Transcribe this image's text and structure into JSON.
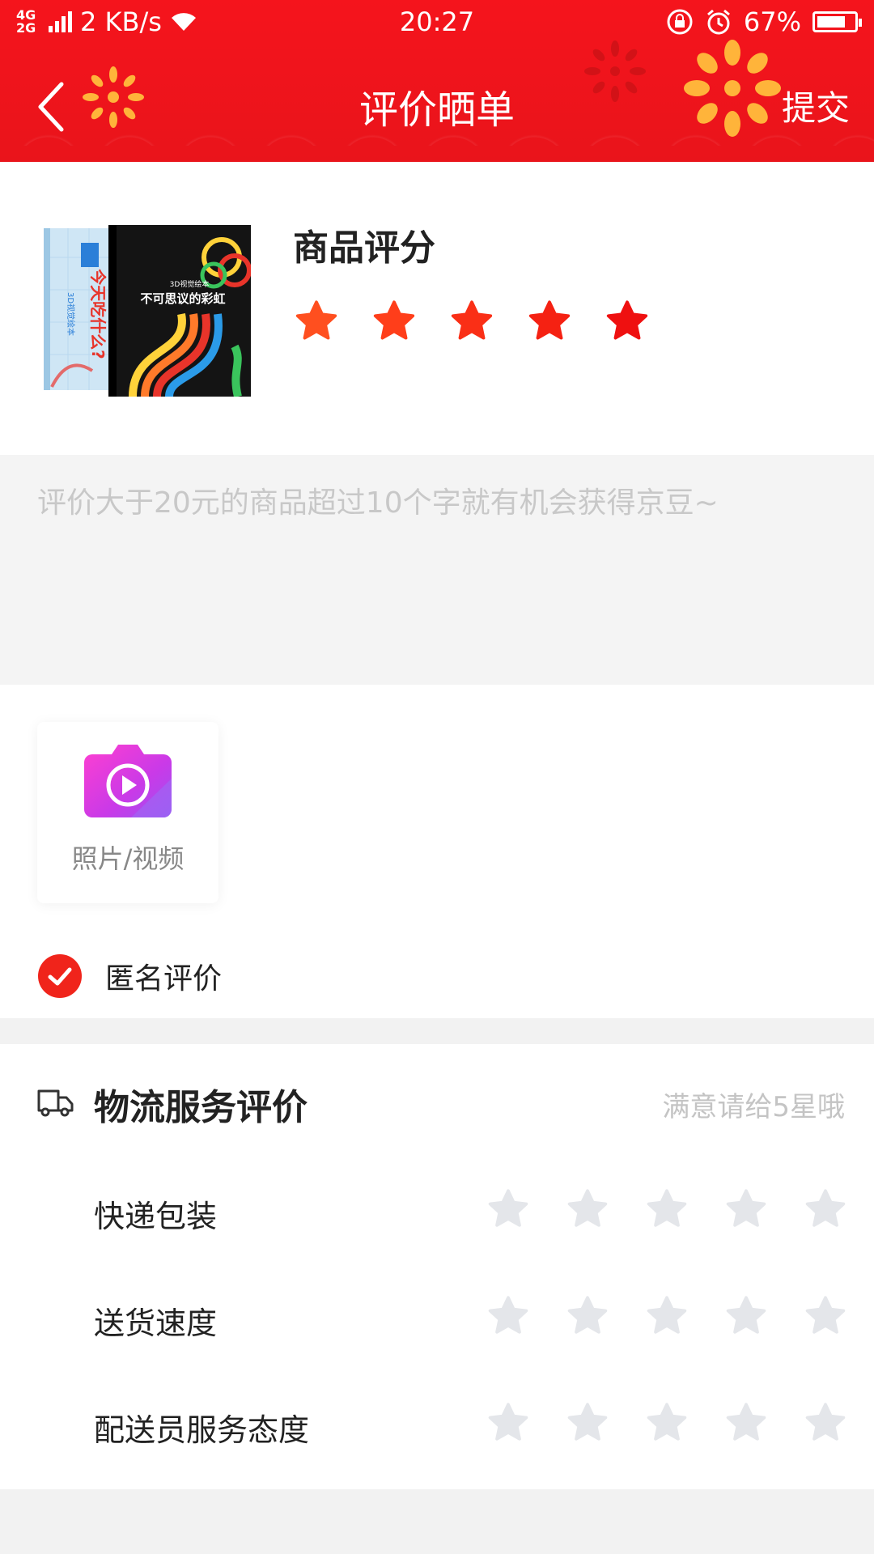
{
  "status_bar": {
    "network": "4G 2G",
    "speed": "2 KB/s",
    "time": "20:27",
    "battery_percent": "67%",
    "battery_level": 0.67
  },
  "nav": {
    "title": "评价晒单",
    "submit_label": "提交"
  },
  "product": {
    "rating_title": "商品评分",
    "rating": 5,
    "max_rating": 5,
    "star_colors": [
      "#ff4f1f",
      "#ff3e1a",
      "#fa2f16",
      "#f52112",
      "#ef1010"
    ],
    "cover": {
      "book_left_title": "今天吃什么?",
      "book_left_series": "3D视觉绘本",
      "book_right_series": "3D视觉绘本",
      "book_right_title": "不可思议的彩虹"
    }
  },
  "review": {
    "placeholder": "评价大于20元的商品超过10个字就有机会获得京豆~"
  },
  "media": {
    "label": "照片/视频",
    "icon": "camera-video-icon"
  },
  "anonymous": {
    "label": "匿名评价",
    "checked": true,
    "color": "#f0241b"
  },
  "logistics": {
    "title": "物流服务评价",
    "hint": "满意请给5星哦",
    "rows": [
      {
        "label": "快递包装",
        "rating": 0
      },
      {
        "label": "送货速度",
        "rating": 0
      },
      {
        "label": "配送员服务态度",
        "rating": 0
      }
    ],
    "empty_star_color": "#e4e6ea"
  }
}
